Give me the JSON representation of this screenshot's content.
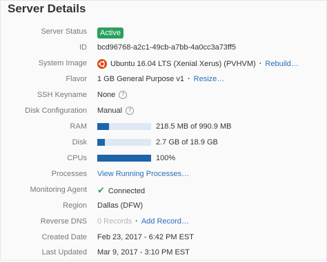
{
  "header": {
    "title": "Server Details"
  },
  "status": {
    "label": "Server Status",
    "value": "Active"
  },
  "id": {
    "label": "ID",
    "value": "bcd96768-a2c1-49cb-a7bb-4a0cc3a73ff5"
  },
  "image": {
    "label": "System Image",
    "value": "Ubuntu 16.04 LTS (Xenial Xerus) (PVHVM)",
    "action": "Rebuild…",
    "icon": "ubuntu-logo-icon",
    "icon_color": "#dd4814"
  },
  "flavor": {
    "label": "Flavor",
    "value": "1 GB General Purpose v1",
    "action": "Resize…"
  },
  "ssh": {
    "label": "SSH Keyname",
    "value": "None"
  },
  "disk_config": {
    "label": "Disk Configuration",
    "value": "Manual"
  },
  "ram": {
    "label": "RAM",
    "value": "218.5 MB of 990.9 MB",
    "fraction": 0.2205
  },
  "disk": {
    "label": "Disk",
    "value": "2.7 GB of 18.9 GB",
    "fraction": 0.1429
  },
  "cpus": {
    "label": "CPUs",
    "value": "100%",
    "fraction": 1.0
  },
  "processes": {
    "label": "Processes",
    "action": "View Running Processes…"
  },
  "monitoring": {
    "label": "Monitoring Agent",
    "value": "Connected",
    "icon": "check-icon"
  },
  "region": {
    "label": "Region",
    "value": "Dallas (DFW)"
  },
  "rdns": {
    "label": "Reverse DNS",
    "value": "0 Records",
    "action": "Add Record…"
  },
  "created": {
    "label": "Created Date",
    "value": "Feb 23, 2017 - 6:42 PM EST"
  },
  "updated": {
    "label": "Last Updated",
    "value": "Mar 9, 2017 - 3:10 PM EST"
  },
  "colors": {
    "accent": "#2a6fb8",
    "status_active": "#2aa05b",
    "bar_fill": "#1e64aa",
    "bar_track": "#dde8f2"
  }
}
